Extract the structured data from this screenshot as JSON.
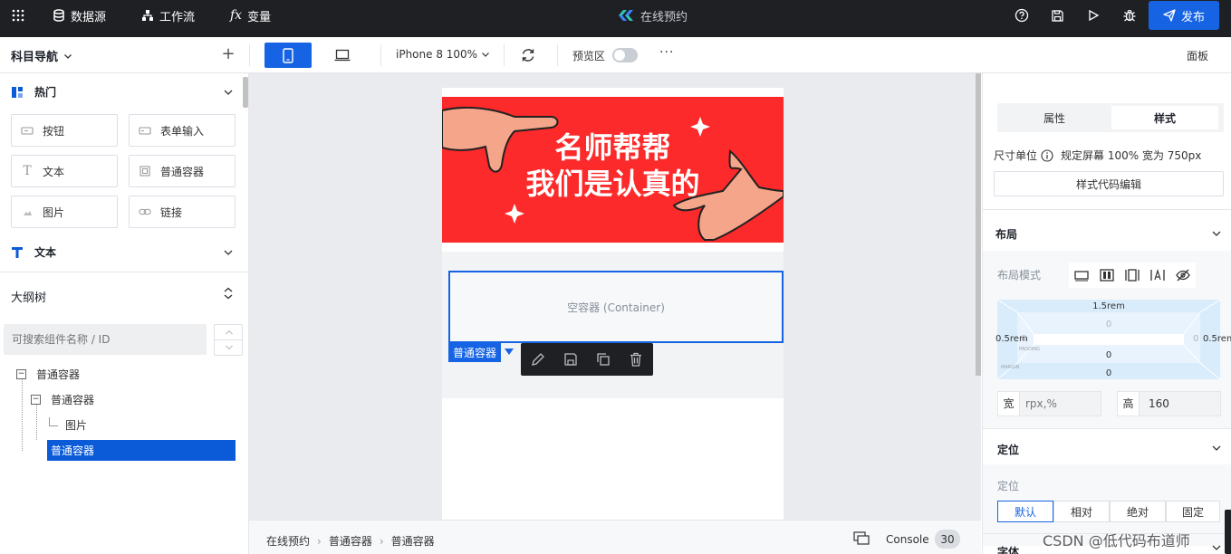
{
  "topbar": {
    "datasource": "数据源",
    "workflow": "工作流",
    "variable": "变量",
    "app_title": "在线预约",
    "publish": "发布"
  },
  "toolbar": {
    "nav_title": "科目导航",
    "add": "+",
    "device": "iPhone 8 100%",
    "preview": "预览区",
    "preview_on": false,
    "more": "···",
    "panel": "面板"
  },
  "components": {
    "hot_title": "热门",
    "items": [
      "按钮",
      "表单输入",
      "文本",
      "普通容器",
      "图片",
      "链接"
    ],
    "text_title": "文本"
  },
  "outline": {
    "title": "大纲树",
    "search_placeholder": "可搜索组件名称 / ID",
    "nodes": [
      "普通容器",
      "普通容器",
      "图片",
      "普通容器"
    ]
  },
  "canvas": {
    "banner_line1": "名师帮帮",
    "banner_line2": "我们是认真的",
    "container_placeholder": "空容器 (Container)",
    "selected_label": "普通容器"
  },
  "breadcrumb": [
    "在线预约",
    "普通容器",
    "普通容器"
  ],
  "console": {
    "label": "Console",
    "count": "30"
  },
  "right": {
    "tabs": [
      "属性",
      "样式"
    ],
    "active_tab": "样式",
    "unit_label": "尺寸单位",
    "unit_value": "规定屏幕 100% 宽为 750px",
    "code_edit": "样式代码编辑",
    "layout_title": "布局",
    "layout_mode_label": "布局模式",
    "box": {
      "margin_top": "1.5rem",
      "margin_left": "0.5rem",
      "margin_right": "0.5rem",
      "margin_bottom": "0",
      "padding_top": "0",
      "padding_left": "0",
      "padding_right": "0",
      "padding_bottom": "0",
      "padding_caption": "PADDING",
      "margin_caption": "MARGIN"
    },
    "width_label": "宽",
    "width_placeholder": "rpx,%",
    "height_label": "高",
    "height_value": "160",
    "position_title": "定位",
    "position_label": "定位",
    "position_options": [
      "默认",
      "相对",
      "绝对",
      "固定"
    ],
    "position_selected": "默认",
    "font_title": "字体"
  },
  "watermark": "CSDN @低代码布道师",
  "colors": {
    "accent": "#0b5bd8",
    "banner": "#fc2a2a",
    "topbar": "#1f2024"
  }
}
